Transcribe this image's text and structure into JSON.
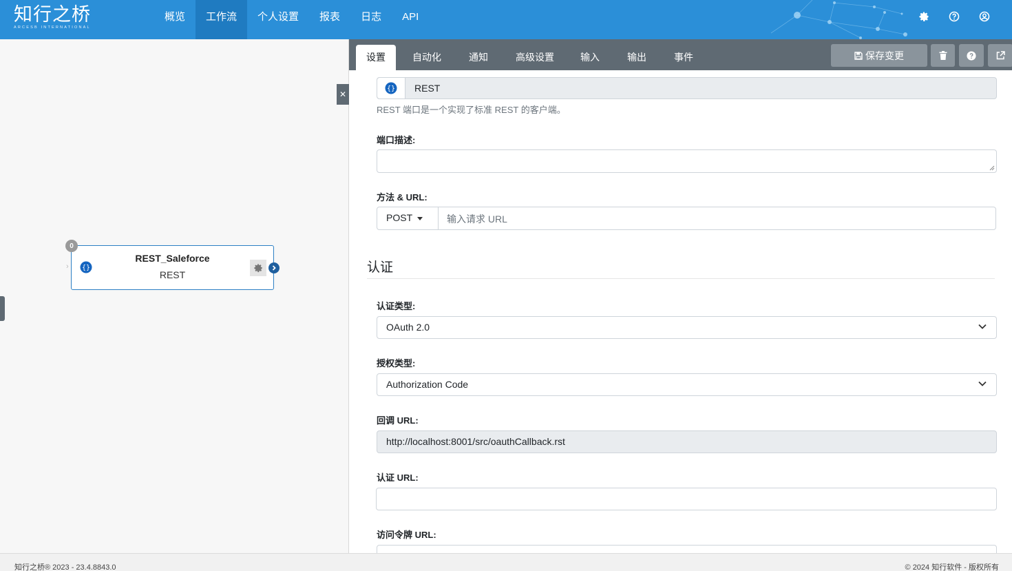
{
  "header": {
    "logo_text": "知行之桥",
    "logo_subtext": "ARCESB INTERNATIONAL",
    "nav": [
      {
        "label": "概览",
        "active": false
      },
      {
        "label": "工作流",
        "active": true
      },
      {
        "label": "个人设置",
        "active": false
      },
      {
        "label": "报表",
        "active": false
      },
      {
        "label": "日志",
        "active": false
      },
      {
        "label": "API",
        "active": false
      }
    ],
    "icons": [
      "gear-icon",
      "help-icon",
      "user-icon"
    ]
  },
  "canvas": {
    "node": {
      "badge": "0",
      "name": "REST_Saleforce",
      "type": "REST"
    }
  },
  "panel": {
    "tabs": [
      {
        "label": "设置",
        "active": true
      },
      {
        "label": "自动化",
        "active": false
      },
      {
        "label": "通知",
        "active": false
      },
      {
        "label": "高级设置",
        "active": false
      },
      {
        "label": "输入",
        "active": false
      },
      {
        "label": "输出",
        "active": false
      },
      {
        "label": "事件",
        "active": false
      }
    ],
    "save_label": "保存变更",
    "connector_type": "REST",
    "connector_help": "REST 端口是一个实现了标准 REST 的客户端。",
    "desc_label": "端口描述:",
    "desc_value": "",
    "method_label": "方法 & URL:",
    "method_value": "POST",
    "url_placeholder": "输入请求 URL",
    "auth_section": "认证",
    "auth_type_label": "认证类型:",
    "auth_type_value": "OAuth 2.0",
    "grant_type_label": "授权类型:",
    "grant_type_value": "Authorization Code",
    "callback_label": "回调 URL:",
    "callback_value": "http://localhost:8001/src/oauthCallback.rst",
    "auth_url_label": "认证 URL:",
    "auth_url_value": "",
    "token_url_label": "访问令牌 URL:"
  },
  "footer": {
    "left": "知行之桥® 2023 - 23.4.8843.0",
    "right": "© 2024 知行软件 - 版权所有"
  },
  "colors": {
    "header_bg": "#2b8fd8",
    "nav_active_bg": "#1f7bc1",
    "tabbar_bg": "#5f6a73",
    "toolbar_btn_bg": "#8a949c",
    "node_border": "#2b7fc4"
  }
}
